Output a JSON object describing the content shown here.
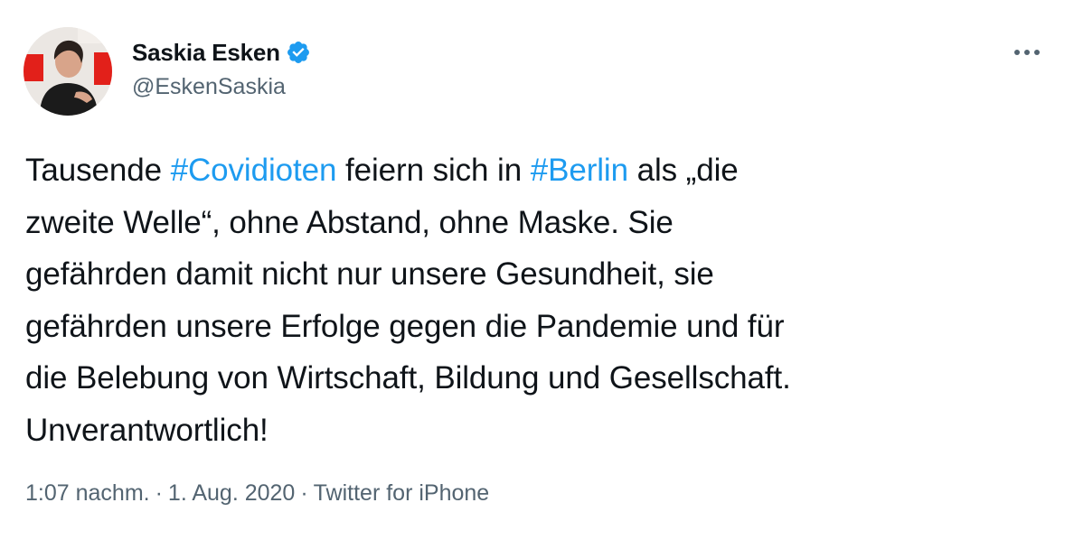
{
  "author": {
    "display_name": "Saskia Esken",
    "handle": "@EskenSaskia",
    "verified": true,
    "avatar_icon": "profile-photo"
  },
  "more_icon": "more-horizontal-icon",
  "tweet": {
    "lines": [
      [
        {
          "text": "Tausende ",
          "type": "text"
        },
        {
          "text": "#Covidioten",
          "type": "hashtag"
        },
        {
          "text": " feiern sich in ",
          "type": "text"
        },
        {
          "text": "#Berlin",
          "type": "hashtag"
        },
        {
          "text": " als „die",
          "type": "text"
        }
      ],
      [
        {
          "text": "zweite Welle“, ohne Abstand, ohne Maske. Sie",
          "type": "text"
        }
      ],
      [
        {
          "text": "gefährden damit nicht nur unsere Gesundheit, sie",
          "type": "text"
        }
      ],
      [
        {
          "text": "gefährden unsere Erfolge gegen die Pandemie und für",
          "type": "text"
        }
      ],
      [
        {
          "text": "die Belebung von Wirtschaft, Bildung und Gesellschaft.",
          "type": "text"
        }
      ],
      [
        {
          "text": "Unverantwortlich!",
          "type": "text"
        }
      ]
    ]
  },
  "meta": {
    "time": "1:07 nachm.",
    "separator": "·",
    "date": "1. Aug. 2020",
    "source": "Twitter for iPhone"
  },
  "colors": {
    "hashtag": "#1d9bf0",
    "verified": "#1d9bf0",
    "secondary_text": "#536471",
    "primary_text": "#0f1419"
  }
}
